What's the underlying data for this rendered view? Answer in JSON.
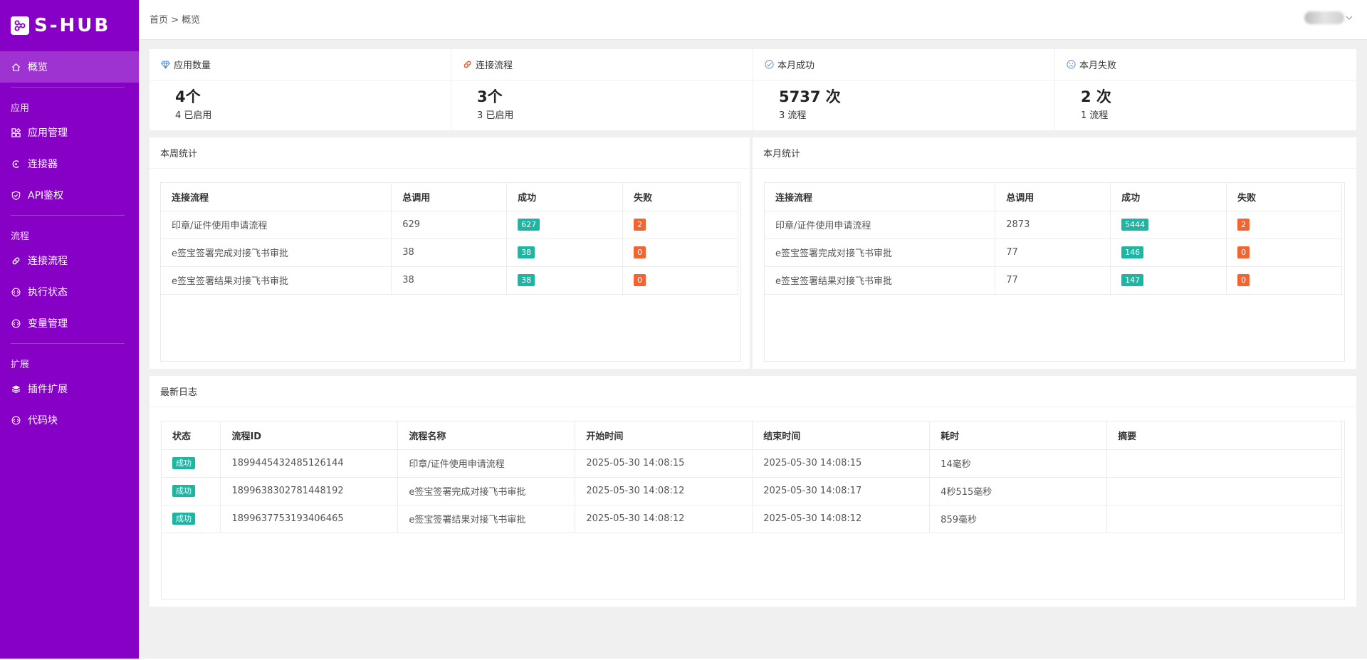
{
  "brand": {
    "name": "S-HUB"
  },
  "sidebar": {
    "top": {
      "label": "概览",
      "icon": "home-icon"
    },
    "groups": [
      {
        "title": "应用",
        "items": [
          {
            "label": "应用管理",
            "icon": "apps-icon"
          },
          {
            "label": "连接器",
            "icon": "connector-icon"
          },
          {
            "label": "API鉴权",
            "icon": "shield-icon"
          }
        ]
      },
      {
        "title": "流程",
        "items": [
          {
            "label": "连接流程",
            "icon": "link-icon"
          },
          {
            "label": "执行状态",
            "icon": "code-circle-icon"
          },
          {
            "label": "变量管理",
            "icon": "code-circle-icon"
          }
        ]
      },
      {
        "title": "扩展",
        "items": [
          {
            "label": "插件扩展",
            "icon": "layers-icon"
          },
          {
            "label": "代码块",
            "icon": "code-circle-icon"
          }
        ]
      }
    ]
  },
  "header": {
    "breadcrumb": "首页 > 概览"
  },
  "stats": [
    {
      "title": "应用数量",
      "value": "4个",
      "sub": "4 已启用",
      "icon": "diamond-icon"
    },
    {
      "title": "连接流程",
      "value": "3个",
      "sub": "3 已启用",
      "icon": "link-icon"
    },
    {
      "title": "本月成功",
      "value": "5737 次",
      "sub": "3 流程",
      "icon": "check-circle-icon"
    },
    {
      "title": "本月失败",
      "value": "2 次",
      "sub": "1 流程",
      "icon": "sad-face-icon"
    }
  ],
  "colors": {
    "sidebar": "#8600c6",
    "success": "#1fb5a3",
    "fail": "#f26430"
  },
  "week": {
    "title": "本周统计",
    "columns": [
      "连接流程",
      "总调用",
      "成功",
      "失败"
    ],
    "rows": [
      [
        "印章/证件使用申请流程",
        "629",
        "627",
        "2"
      ],
      [
        "e签宝签署完成对接飞书审批",
        "38",
        "38",
        "0"
      ],
      [
        "e签宝签署结果对接飞书审批",
        "38",
        "38",
        "0"
      ]
    ]
  },
  "month": {
    "title": "本月统计",
    "columns": [
      "连接流程",
      "总调用",
      "成功",
      "失败"
    ],
    "rows": [
      [
        "印章/证件使用申请流程",
        "2873",
        "5444",
        "2"
      ],
      [
        "e签宝签署完成对接飞书审批",
        "77",
        "146",
        "0"
      ],
      [
        "e签宝签署结果对接飞书审批",
        "77",
        "147",
        "0"
      ]
    ]
  },
  "logs": {
    "title": "最新日志",
    "columns": [
      "状态",
      "流程ID",
      "流程名称",
      "开始时间",
      "结束时间",
      "耗时",
      "摘要"
    ],
    "rows": [
      [
        "成功",
        "1899445432485126144",
        "印章/证件使用申请流程",
        "2025-05-30 14:08:15",
        "2025-05-30 14:08:15",
        "14毫秒",
        ""
      ],
      [
        "成功",
        "1899638302781448192",
        "e签宝签署完成对接飞书审批",
        "2025-05-30 14:08:12",
        "2025-05-30 14:08:17",
        "4秒515毫秒",
        ""
      ],
      [
        "成功",
        "1899637753193406465",
        "e签宝签署结果对接飞书审批",
        "2025-05-30 14:08:12",
        "2025-05-30 14:08:12",
        "859毫秒",
        ""
      ]
    ]
  }
}
